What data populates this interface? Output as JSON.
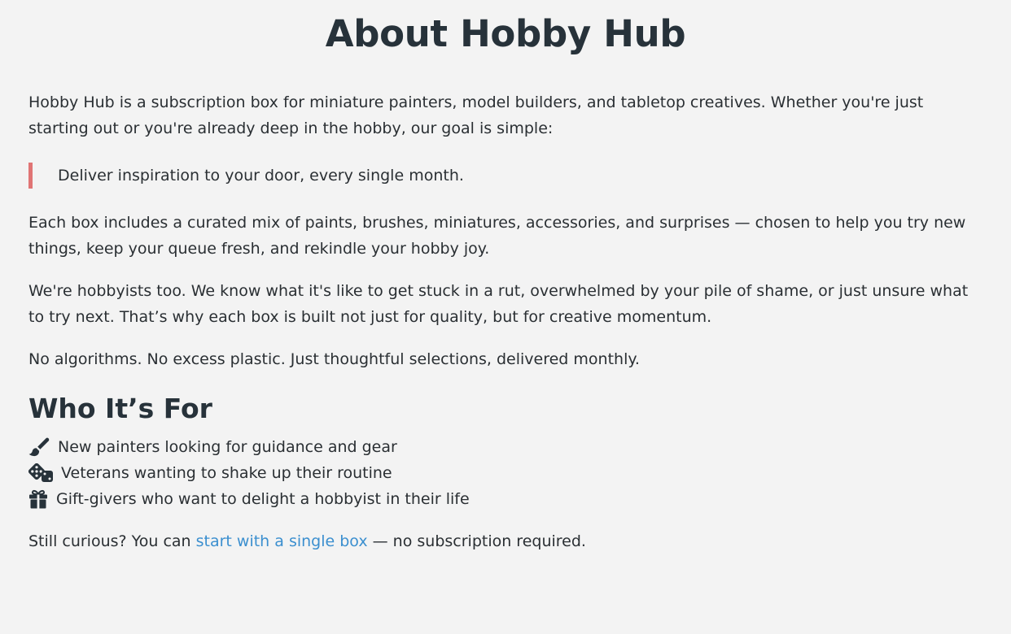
{
  "title": "About Hobby Hub",
  "intro": "Hobby Hub is a subscription box for miniature painters, model builders, and tabletop creatives. Whether you're just starting out or you're already deep in the hobby, our goal is simple:",
  "quote": "Deliver inspiration to your door, every single month.",
  "box_text": "Each box includes a curated mix of paints, brushes, miniatures, accessories, and surprises — chosen to help you try new things, keep your queue fresh, and rekindle your hobby joy.",
  "hobbyists_text": "We're hobbyists too. We know what it's like to get stuck in a rut, overwhelmed by your pile of shame, or just unsure what to try next. That’s why each box is built not just for quality, but for creative momentum.",
  "no_algorithms_text": "No algorithms. No excess plastic. Just thoughtful selections, delivered monthly.",
  "who_heading": "Who It’s For",
  "who_items": [
    {
      "icon": "paintbrush-icon",
      "label": "New painters looking for guidance and gear"
    },
    {
      "icon": "dice-icon",
      "label": "Veterans wanting to shake up their routine"
    },
    {
      "icon": "gift-icon",
      "label": "Gift-givers who want to delight a hobbyist in their life"
    }
  ],
  "closing": {
    "prefix": "Still curious? You can ",
    "link_text": "start with a single box",
    "suffix": " — no subscription required."
  },
  "colors": {
    "background": "#f3f3f3",
    "text": "#2a2f33",
    "quote_border": "#e07474",
    "link": "#3b8fcf"
  }
}
